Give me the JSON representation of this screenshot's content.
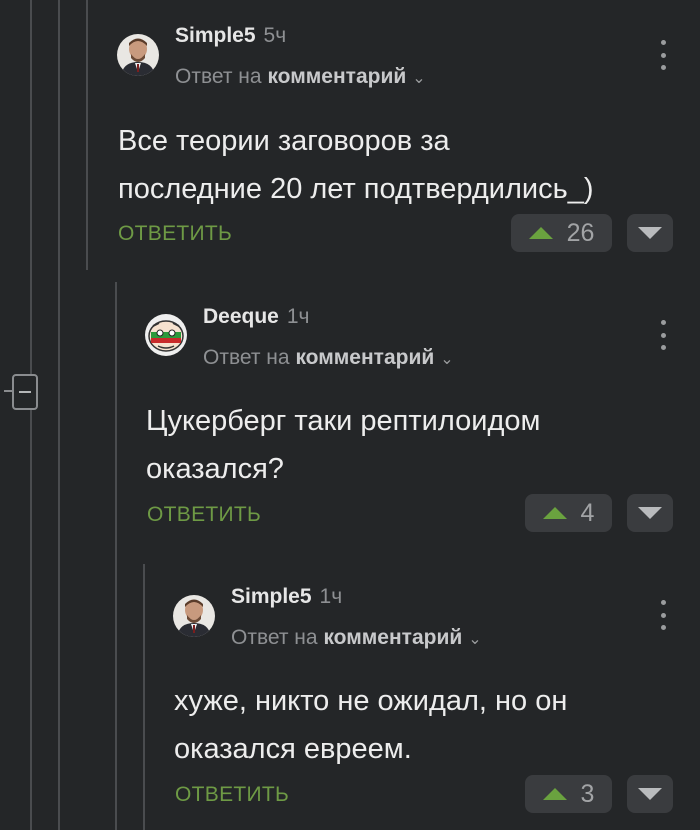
{
  "comments": [
    {
      "author": "Simple5",
      "time": "5ч",
      "reply_prefix": "Ответ на",
      "reply_target": "комментарий",
      "text_lines": [
        "Все теории заговоров за",
        "последние 20 лет подтвердились_)"
      ],
      "reply_label": "ОТВЕТИТЬ",
      "votes": "26"
    },
    {
      "author": "Deeque",
      "time": "1ч",
      "reply_prefix": "Ответ на",
      "reply_target": "комментарий",
      "text_lines": [
        "Цукерберг таки рептилоидом",
        "оказался?"
      ],
      "reply_label": "ОТВЕТИТЬ",
      "votes": "4"
    },
    {
      "author": "Simple5",
      "time": "1ч",
      "reply_prefix": "Ответ на",
      "reply_target": "комментарий",
      "text_lines": [
        "хуже, никто не ожидал, но он",
        "оказался евреем."
      ],
      "reply_label": "ОТВЕТИТЬ",
      "votes": "3"
    }
  ],
  "icons": {
    "collapse": "minus-square-icon",
    "menu": "kebab-menu-icon",
    "upvote": "triangle-up-icon",
    "downvote": "triangle-down-icon",
    "chevron": "chevron-down-icon"
  },
  "colors": {
    "background": "#242628",
    "accent_green": "#6e9a45",
    "upvote_green": "#6aa23f"
  }
}
